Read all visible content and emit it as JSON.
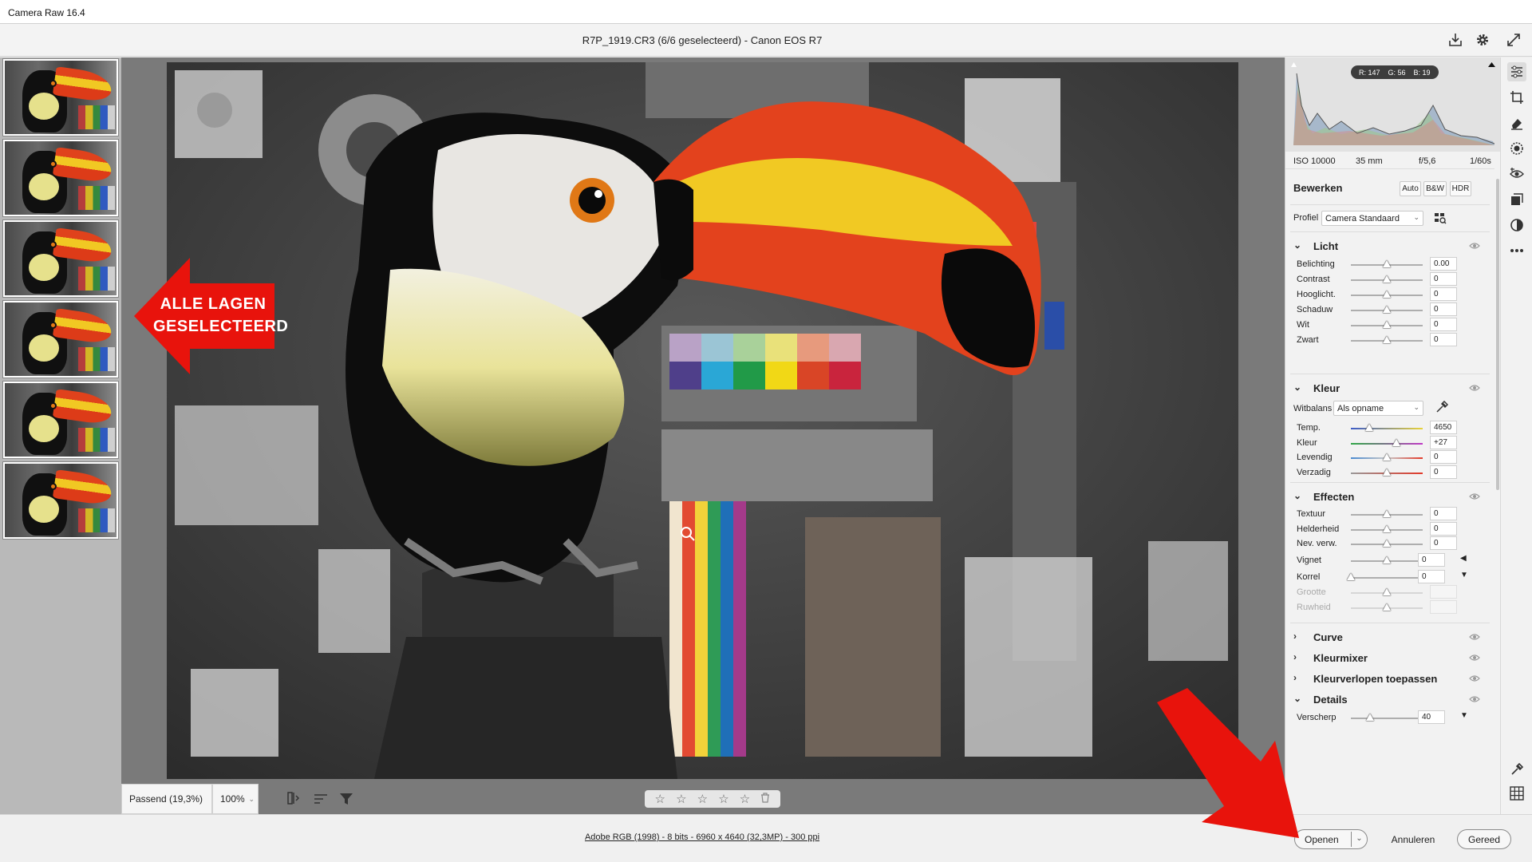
{
  "window": {
    "title": "Camera Raw 16.4"
  },
  "header": {
    "file_title": "R7P_1919.CR3 (6/6 geselecteerd)  -  Canon EOS R7"
  },
  "annotation": {
    "line1": "ALLE LAGEN",
    "line2": "GESELECTEERD"
  },
  "viewer": {
    "zoom_fit": "Passend (19,3%)",
    "zoom_pct": "100%",
    "stars": [
      "☆",
      "☆",
      "☆",
      "☆",
      "☆"
    ]
  },
  "histogram": {
    "r": "R: 147",
    "g": "G: 56",
    "b": "B: 19"
  },
  "camera": {
    "iso": "ISO 10000",
    "focal": "35 mm",
    "aperture": "f/5,6",
    "shutter": "1/60s"
  },
  "edit": {
    "title": "Bewerken",
    "auto": "Auto",
    "bw": "B&W",
    "hdr": "HDR",
    "profile_label": "Profiel",
    "profile_value": "Camera Standaard"
  },
  "licht": {
    "title": "Licht",
    "rows": [
      {
        "label": "Belichting",
        "value": "0.00",
        "pos": 0.5
      },
      {
        "label": "Contrast",
        "value": "0",
        "pos": 0.5
      },
      {
        "label": "Hooglicht.",
        "value": "0",
        "pos": 0.5
      },
      {
        "label": "Schaduw",
        "value": "0",
        "pos": 0.5
      },
      {
        "label": "Wit",
        "value": "0",
        "pos": 0.5
      },
      {
        "label": "Zwart",
        "value": "0",
        "pos": 0.5
      }
    ]
  },
  "kleur": {
    "title": "Kleur",
    "wb_label": "Witbalans",
    "wb_value": "Als opname",
    "rows": [
      {
        "label": "Temp.",
        "value": "4650",
        "pos": 0.26
      },
      {
        "label": "Kleur",
        "value": "+27",
        "pos": 0.63
      },
      {
        "label": "Levendig",
        "value": "0",
        "pos": 0.5
      },
      {
        "label": "Verzadig",
        "value": "0",
        "pos": 0.5
      }
    ]
  },
  "effecten": {
    "title": "Effecten",
    "rows": [
      {
        "label": "Textuur",
        "value": "0",
        "pos": 0.5
      },
      {
        "label": "Helderheid",
        "value": "0",
        "pos": 0.5
      },
      {
        "label": "Nev. verw.",
        "value": "0",
        "pos": 0.5
      },
      {
        "label": "Vignet",
        "value": "0",
        "pos": 0.5
      },
      {
        "label": "Korrel",
        "value": "0",
        "pos": 0.0
      },
      {
        "label": "Grootte",
        "value": "",
        "pos": 0.5
      },
      {
        "label": "Ruwheid",
        "value": "",
        "pos": 0.5
      }
    ]
  },
  "collapsed": [
    "Curve",
    "Kleurmixer",
    "Kleurverlopen toepassen"
  ],
  "details": {
    "title": "Details",
    "rows": [
      {
        "label": "Verscherp",
        "value": "40",
        "pos": 0.27
      }
    ]
  },
  "status": {
    "info": "Adobe RGB (1998) - 8 bits - 6960 x 4640 (32,3MP) - 300 ppi"
  },
  "buttons": {
    "open": "Openen",
    "cancel": "Annuleren",
    "done": "Gereed"
  },
  "colors": {
    "accent_red": "#e8130c",
    "panel_bg": "#f2f2f2",
    "viewer_bg": "#7a7a7a"
  }
}
